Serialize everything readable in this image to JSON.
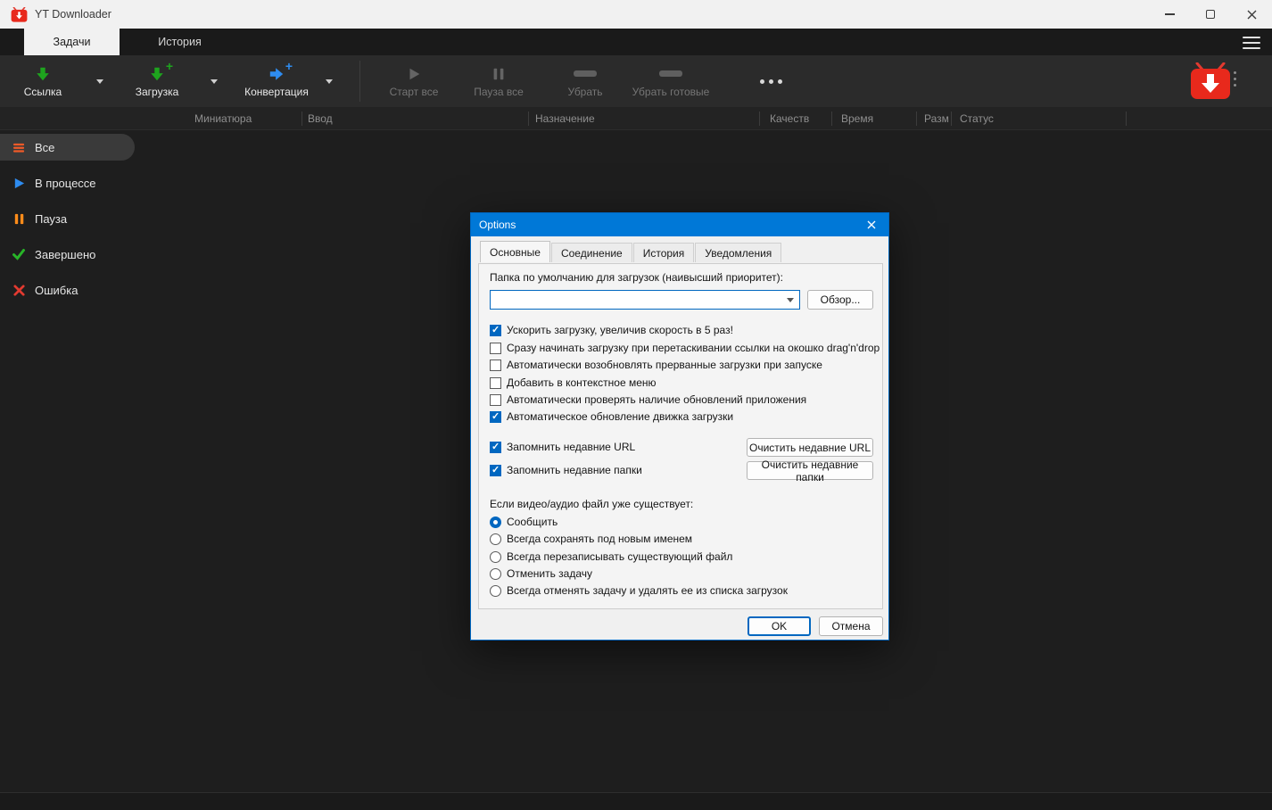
{
  "window": {
    "title": "YT Downloader"
  },
  "tabs": {
    "tasks": "Задачи",
    "history": "История"
  },
  "icons": {
    "plus_glyph": "+"
  },
  "toolbar": {
    "link": "Ссылка",
    "download": "Загрузка",
    "convert": "Конвертация",
    "start_all": "Старт все",
    "pause_all": "Пауза все",
    "remove": "Убрать",
    "remove_done": "Убрать готовые"
  },
  "columns": [
    "Миниатюра",
    "Ввод",
    "Назначение",
    "Качеств",
    "Время",
    "Разм",
    "Статус"
  ],
  "sidebar": {
    "items": [
      {
        "label": "Все"
      },
      {
        "label": "В процессе"
      },
      {
        "label": "Пауза"
      },
      {
        "label": "Завершено"
      },
      {
        "label": "Ошибка"
      }
    ]
  },
  "dialog": {
    "title": "Options",
    "tabs": [
      {
        "label": "Основные"
      },
      {
        "label": "Соединение"
      },
      {
        "label": "История"
      },
      {
        "label": "Уведомления"
      }
    ],
    "folder_label": "Папка по умолчанию для загрузок (наивысший приоритет):",
    "folder_value": "",
    "browse_button": "Обзор...",
    "checkboxes": [
      {
        "label": "Ускорить загрузку, увеличив скорость в 5 раз!",
        "checked": true
      },
      {
        "label": "Сразу начинать загрузку при перетаскивании ссылки на окошко drag'n'drop",
        "checked": false
      },
      {
        "label": "Автоматически возобновлять прерванные загрузки при запуске",
        "checked": false
      },
      {
        "label": "Добавить в контекстное меню",
        "checked": false
      },
      {
        "label": "Автоматически проверять наличие обновлений приложения",
        "checked": false
      },
      {
        "label": "Автоматическое обновление движка загрузки",
        "checked": true
      }
    ],
    "remember_url": {
      "label": "Запомнить недавние URL",
      "checked": true,
      "clear_button": "Очистить недавние URL"
    },
    "remember_folders": {
      "label": "Запомнить недавние папки",
      "checked": true,
      "clear_button": "Очистить недавние папки"
    },
    "exists_label": "Если видео/аудио файл уже существует:",
    "radios": [
      {
        "label": "Сообщить",
        "selected": true
      },
      {
        "label": "Всегда сохранять под новым именем",
        "selected": false
      },
      {
        "label": "Всегда перезаписывать существующий файл",
        "selected": false
      },
      {
        "label": "Отменить задачу",
        "selected": false
      },
      {
        "label": "Всегда отменять задачу и удалять ее из списка загрузок",
        "selected": false
      }
    ],
    "ok_button": "OK",
    "cancel_button": "Отмена"
  },
  "colors": {
    "accent_blue": "#0078d7",
    "brand_red": "#e8291c",
    "download_green": "#1ea41e",
    "convert_blue": "#2e8cf0",
    "pause_orange": "#ff8c1a",
    "done_green": "#28b428",
    "error_red": "#e23a30"
  }
}
